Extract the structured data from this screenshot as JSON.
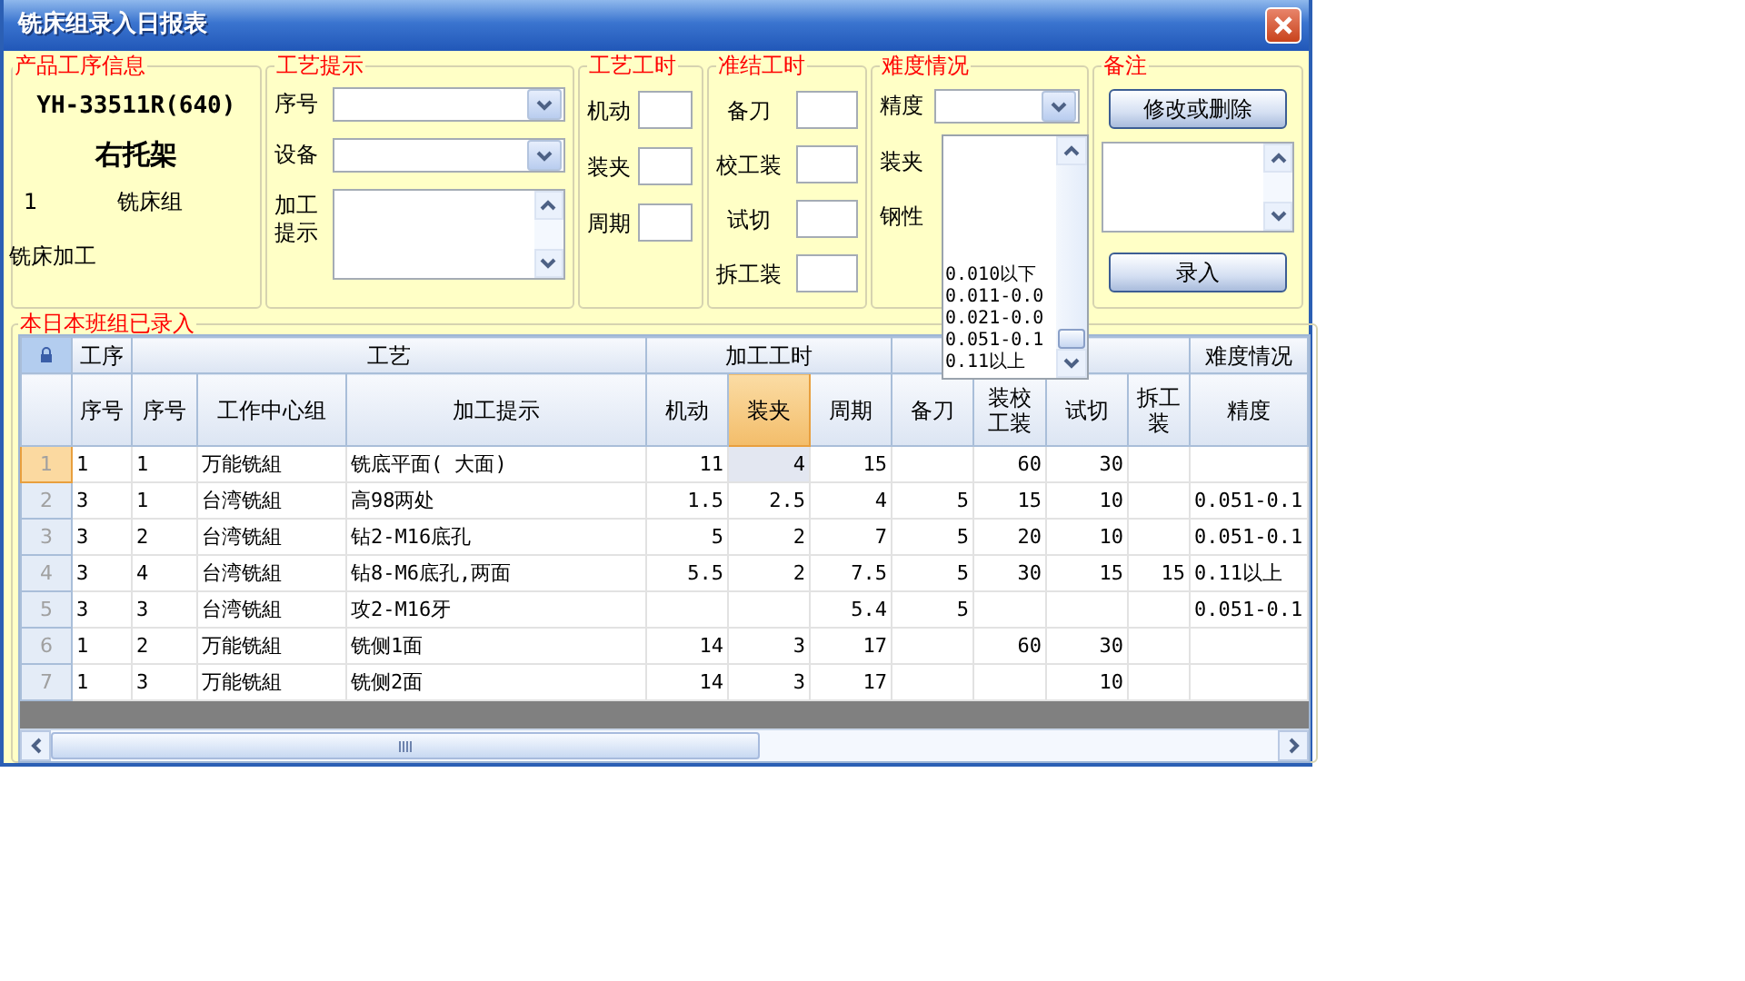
{
  "window": {
    "title": "铣床组录入日报表"
  },
  "product_info": {
    "legend": "产品工序信息",
    "part_number": "YH-33511R(640)",
    "part_name": "右托架",
    "sequence": "1",
    "group": "铣床组",
    "process": "铣床加工"
  },
  "process_hint": {
    "legend": "工艺提示",
    "fields": [
      {
        "label": "序号",
        "kind": "dropdown"
      },
      {
        "label": "设备",
        "kind": "dropdown"
      },
      {
        "label": "加工提示",
        "kind": "textarea"
      }
    ]
  },
  "process_time": {
    "legend": "工艺工时",
    "fields": [
      "机动",
      "装夹",
      "周期"
    ]
  },
  "setup_time": {
    "legend": "准结工时",
    "fields": [
      "备刀",
      "校工装",
      "试切",
      "拆工装"
    ]
  },
  "difficulty": {
    "legend": "难度情况",
    "labels": [
      "精度",
      "装夹",
      "钢性"
    ],
    "options": [
      "0.010以下",
      "0.011-0.0",
      "0.021-0.0",
      "0.051-0.1",
      "0.11以上"
    ]
  },
  "notes": {
    "legend": "备注",
    "buttons": [
      "修改或删除",
      "录入"
    ]
  },
  "grid": {
    "legend": "本日本班组已录入",
    "column_groups": [
      {
        "label": "工序",
        "columns": [
          {
            "label": "序号",
            "kind": "text",
            "selected": false
          }
        ]
      },
      {
        "label": "工艺",
        "columns": [
          {
            "label": "序号",
            "kind": "text",
            "selected": false
          },
          {
            "label": "工作中心组",
            "kind": "text",
            "selected": false
          },
          {
            "label": "加工提示",
            "kind": "text",
            "selected": false
          }
        ]
      },
      {
        "label": "加工工时",
        "columns": [
          {
            "label": "机动",
            "kind": "number",
            "selected": false
          },
          {
            "label": "装夹",
            "kind": "number",
            "selected": true
          },
          {
            "label": "周期",
            "kind": "number",
            "selected": false
          }
        ]
      },
      {
        "columns": [
          {
            "label": "备刀",
            "kind": "number",
            "selected": false
          },
          {
            "label": "装校工装",
            "kind": "number",
            "selected": false
          },
          {
            "label": "试切",
            "kind": "number",
            "selected": false
          },
          {
            "label": "拆工装",
            "kind": "number",
            "selected": false
          }
        ]
      },
      {
        "label": "难度情况",
        "columns": [
          {
            "label": "精度",
            "kind": "text",
            "selected": false
          }
        ]
      }
    ],
    "rows": [
      {
        "number": "1",
        "selected": true,
        "cells": [
          "1",
          "1",
          "万能铣組",
          "铣底平面( 大面)",
          "11",
          "4",
          "15",
          "",
          "60",
          "30",
          "",
          ""
        ]
      },
      {
        "number": "2",
        "selected": false,
        "cells": [
          "3",
          "1",
          "台湾铣組",
          "高98两处",
          "1.5",
          "2.5",
          "4",
          "5",
          "15",
          "10",
          "",
          "0.051-0.1"
        ]
      },
      {
        "number": "3",
        "selected": false,
        "cells": [
          "3",
          "2",
          "台湾铣組",
          "钻2-M16底孔",
          "5",
          "2",
          "7",
          "5",
          "20",
          "10",
          "",
          "0.051-0.1"
        ]
      },
      {
        "number": "4",
        "selected": false,
        "cells": [
          "3",
          "4",
          "台湾铣組",
          "钻8-M6底孔,两面",
          "5.5",
          "2",
          "7.5",
          "5",
          "30",
          "15",
          "15",
          "0.11以上"
        ]
      },
      {
        "number": "5",
        "selected": false,
        "cells": [
          "3",
          "3",
          "台湾铣組",
          "攻2-M16牙",
          "",
          "",
          "5.4",
          "5",
          "",
          "",
          "",
          "0.051-0.1"
        ]
      },
      {
        "number": "6",
        "selected": false,
        "cells": [
          "1",
          "2",
          "万能铣組",
          "铣侧1面",
          "14",
          "3",
          "17",
          "",
          "60",
          "30",
          "",
          ""
        ]
      },
      {
        "number": "7",
        "selected": false,
        "cells": [
          "1",
          "3",
          "万能铣組",
          "铣侧2面",
          "14",
          "3",
          "17",
          "",
          "",
          "10",
          "",
          ""
        ]
      }
    ]
  }
}
